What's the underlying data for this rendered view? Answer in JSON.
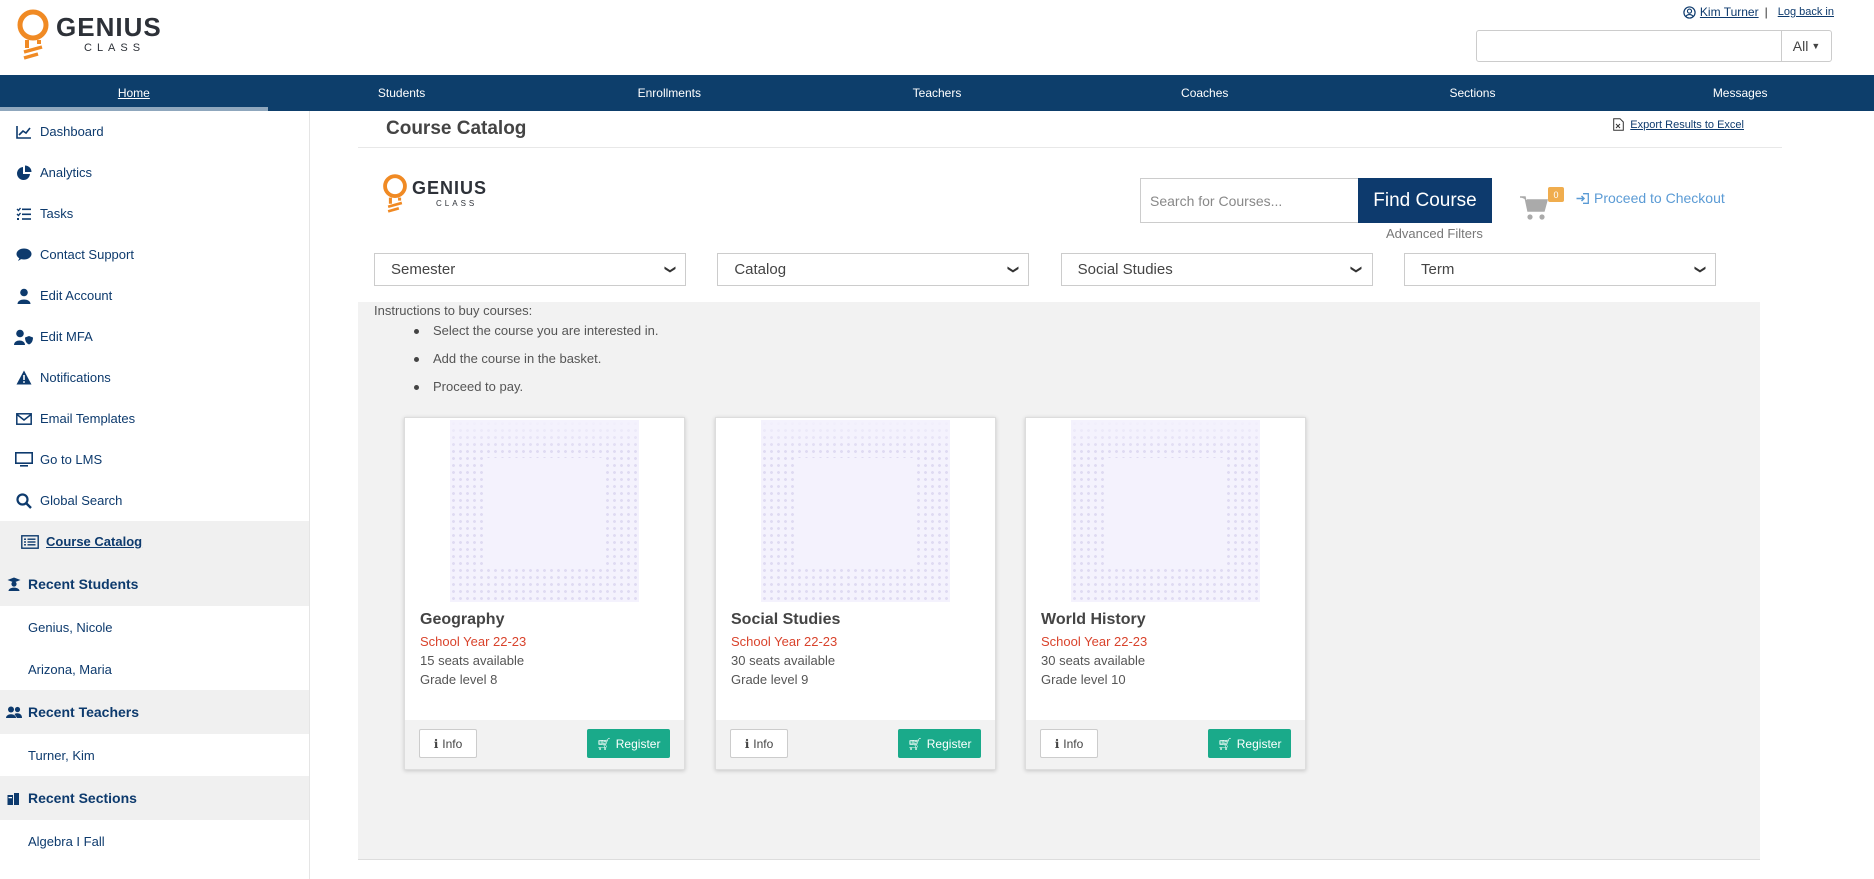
{
  "header": {
    "logo_title": "GENIUS",
    "logo_sub": "CLASS",
    "user_name": "Kim Turner",
    "separator": "|",
    "log_back": "Log back in",
    "search_value": "",
    "search_scope": "All"
  },
  "nav": {
    "items": [
      "Home",
      "Students",
      "Enrollments",
      "Teachers",
      "Coaches",
      "Sections",
      "Messages"
    ]
  },
  "sidebar": {
    "items": [
      {
        "label": "Dashboard",
        "icon": "chart-line-icon"
      },
      {
        "label": "Analytics",
        "icon": "pie-chart-icon"
      },
      {
        "label": "Tasks",
        "icon": "task-list-icon"
      },
      {
        "label": "Contact Support",
        "icon": "chat-icon"
      },
      {
        "label": "Edit Account",
        "icon": "user-icon"
      },
      {
        "label": "Edit MFA",
        "icon": "user-shield-icon"
      },
      {
        "label": "Notifications",
        "icon": "warning-icon"
      },
      {
        "label": "Email Templates",
        "icon": "envelope-icon"
      },
      {
        "label": "Go to LMS",
        "icon": "monitor-icon"
      },
      {
        "label": "Global Search",
        "icon": "search-icon"
      },
      {
        "label": "Course Catalog",
        "icon": "catalog-list-icon"
      }
    ],
    "recent_students_title": "Recent Students",
    "recent_students": [
      "Genius, Nicole",
      "Arizona, Maria"
    ],
    "recent_teachers_title": "Recent Teachers",
    "recent_teachers": [
      "Turner, Kim"
    ],
    "recent_sections_title": "Recent Sections",
    "recent_sections": [
      "Algebra I Fall"
    ]
  },
  "main": {
    "page_title": "Course Catalog",
    "export_label": "Export Results to Excel",
    "catalog_logo_title": "GENIUS",
    "catalog_logo_sub": "CLASS",
    "search_placeholder": "Search for Courses...",
    "find_button": "Find Course",
    "advanced_filters": "Advanced Filters",
    "cart_count": "0",
    "checkout_label": "Proceed to Checkout",
    "filters": [
      "Semester",
      "Catalog",
      "Social Studies",
      "Term"
    ],
    "instructions_title": "Instructions to buy courses:",
    "instructions": [
      "Select the course you are interested in.",
      "Add the course in the basket.",
      "Proceed to pay."
    ],
    "courses": [
      {
        "title": "Geography",
        "year": "School Year 22-23",
        "seats": "15 seats available",
        "grade": "Grade level 8",
        "info": "Info",
        "register": "Register"
      },
      {
        "title": "Social Studies",
        "year": "School Year 22-23",
        "seats": "30 seats available",
        "grade": "Grade level 9",
        "info": "Info",
        "register": "Register"
      },
      {
        "title": "World History",
        "year": "School Year 22-23",
        "seats": "30 seats available",
        "grade": "Grade level 10",
        "info": "Info",
        "register": "Register"
      }
    ]
  },
  "colors": {
    "nav_bg": "#0d3e6b",
    "primary": "#0d3a6d",
    "register_green": "#1aaa8a",
    "year_red": "#d9432c",
    "cart_badge": "#f0ad4e",
    "logo_orange": "#f08a24"
  }
}
